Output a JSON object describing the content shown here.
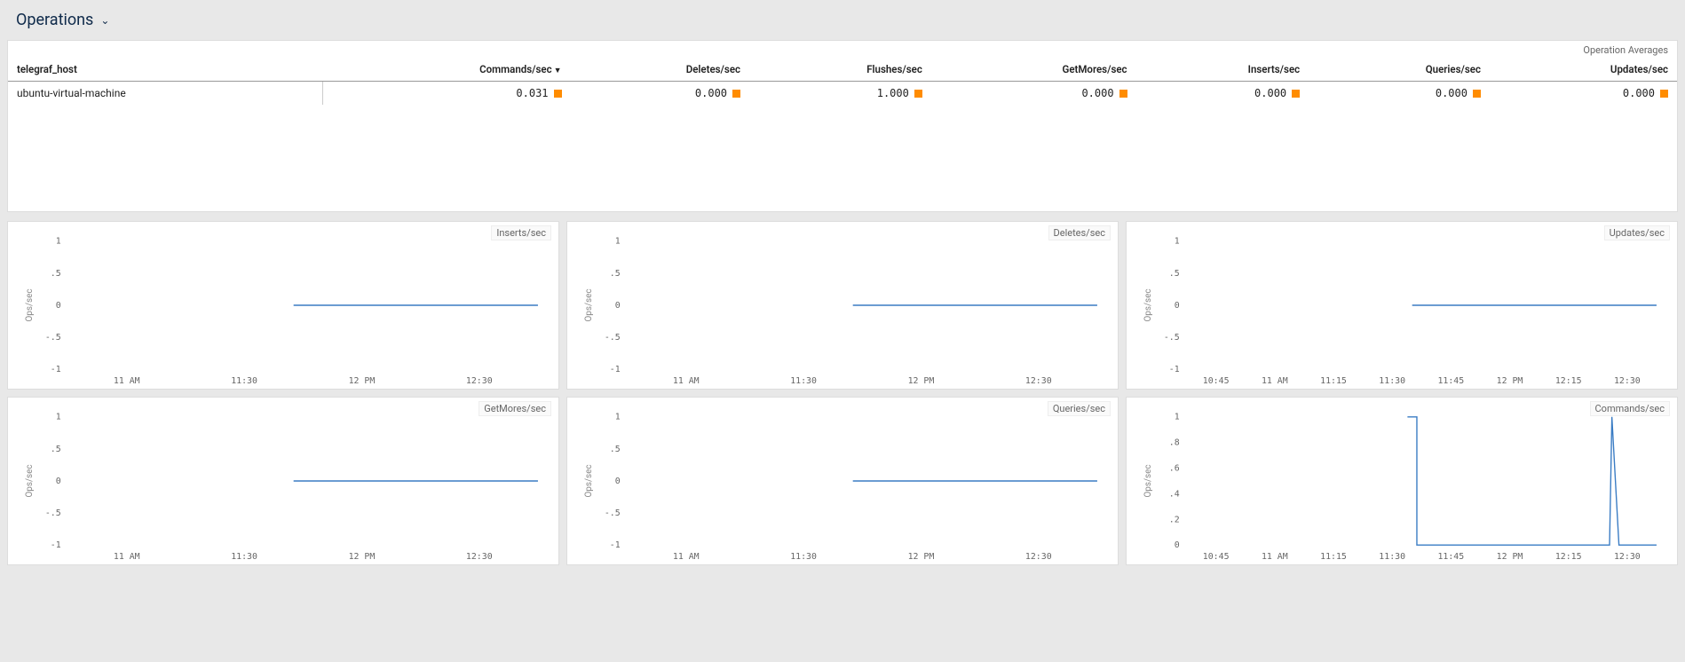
{
  "header": {
    "title": "Operations"
  },
  "table": {
    "subtitle": "Operation Averages",
    "columns": [
      "telegraf_host",
      "Commands/sec",
      "Deletes/sec",
      "Flushes/sec",
      "GetMores/sec",
      "Inserts/sec",
      "Queries/sec",
      "Updates/sec"
    ],
    "sort_column_index": 1,
    "rows": [
      {
        "host": "ubuntu-virtual-machine",
        "values": [
          "0.031",
          "0.000",
          "1.000",
          "0.000",
          "0.000",
          "0.000",
          "0.000"
        ]
      }
    ]
  },
  "charts": [
    {
      "title": "Inserts/sec",
      "ylabel": "Ops/sec",
      "type": "half-zero",
      "xticks_mode": "short"
    },
    {
      "title": "Deletes/sec",
      "ylabel": "Ops/sec",
      "type": "half-zero",
      "xticks_mode": "short"
    },
    {
      "title": "Updates/sec",
      "ylabel": "Ops/sec",
      "type": "half-zero",
      "xticks_mode": "long"
    },
    {
      "title": "GetMores/sec",
      "ylabel": "Ops/sec",
      "type": "half-zero",
      "xticks_mode": "short"
    },
    {
      "title": "Queries/sec",
      "ylabel": "Ops/sec",
      "type": "half-zero",
      "xticks_mode": "short"
    },
    {
      "title": "Commands/sec",
      "ylabel": "Ops/sec",
      "type": "commands",
      "xticks_mode": "long"
    }
  ],
  "xticks": {
    "short": [
      "11 AM",
      "11:30",
      "12 PM",
      "12:30"
    ],
    "long": [
      "10:45",
      "11 AM",
      "11:15",
      "11:30",
      "11:45",
      "12 PM",
      "12:15",
      "12:30"
    ]
  },
  "yticks": {
    "sym": [
      "-1",
      "-.5",
      "0",
      ".5",
      "1"
    ],
    "cmd": [
      "0",
      ".2",
      ".4",
      ".6",
      ".8",
      "1"
    ]
  },
  "chart_data": [
    {
      "type": "line",
      "title": "Inserts/sec",
      "ylabel": "Ops/sec",
      "x": [
        "11 AM",
        "11:30",
        "12 PM",
        "12:30"
      ],
      "ylim": [
        -1,
        1
      ],
      "series": [
        {
          "name": "ubuntu-virtual-machine",
          "values": [
            null,
            0,
            0,
            0
          ]
        }
      ]
    },
    {
      "type": "line",
      "title": "Deletes/sec",
      "ylabel": "Ops/sec",
      "x": [
        "11 AM",
        "11:30",
        "12 PM",
        "12:30"
      ],
      "ylim": [
        -1,
        1
      ],
      "series": [
        {
          "name": "ubuntu-virtual-machine",
          "values": [
            null,
            null,
            0,
            0
          ]
        }
      ]
    },
    {
      "type": "line",
      "title": "Updates/sec",
      "ylabel": "Ops/sec",
      "x": [
        "10:45",
        "11 AM",
        "11:15",
        "11:30",
        "11:45",
        "12 PM",
        "12:15",
        "12:30"
      ],
      "ylim": [
        -1,
        1
      ],
      "series": [
        {
          "name": "ubuntu-virtual-machine",
          "values": [
            null,
            null,
            null,
            null,
            0,
            0,
            0,
            0
          ]
        }
      ]
    },
    {
      "type": "line",
      "title": "GetMores/sec",
      "ylabel": "Ops/sec",
      "x": [
        "11 AM",
        "11:30",
        "12 PM",
        "12:30"
      ],
      "ylim": [
        -1,
        1
      ],
      "series": [
        {
          "name": "ubuntu-virtual-machine",
          "values": [
            null,
            0,
            0,
            0
          ]
        }
      ]
    },
    {
      "type": "line",
      "title": "Queries/sec",
      "ylabel": "Ops/sec",
      "x": [
        "11 AM",
        "11:30",
        "12 PM",
        "12:30"
      ],
      "ylim": [
        -1,
        1
      ],
      "series": [
        {
          "name": "ubuntu-virtual-machine",
          "values": [
            null,
            null,
            0,
            0
          ]
        }
      ]
    },
    {
      "type": "line",
      "title": "Commands/sec",
      "ylabel": "Ops/sec",
      "x": [
        "10:45",
        "11 AM",
        "11:15",
        "11:30",
        "11:45",
        "12 PM",
        "12:15",
        "12:30"
      ],
      "ylim": [
        0,
        1
      ],
      "series": [
        {
          "name": "ubuntu-virtual-machine",
          "values": [
            null,
            null,
            null,
            1,
            0,
            0,
            0,
            0
          ],
          "notes": "spike to 1 near 11:40 and 12:30, otherwise ~0"
        }
      ]
    }
  ]
}
